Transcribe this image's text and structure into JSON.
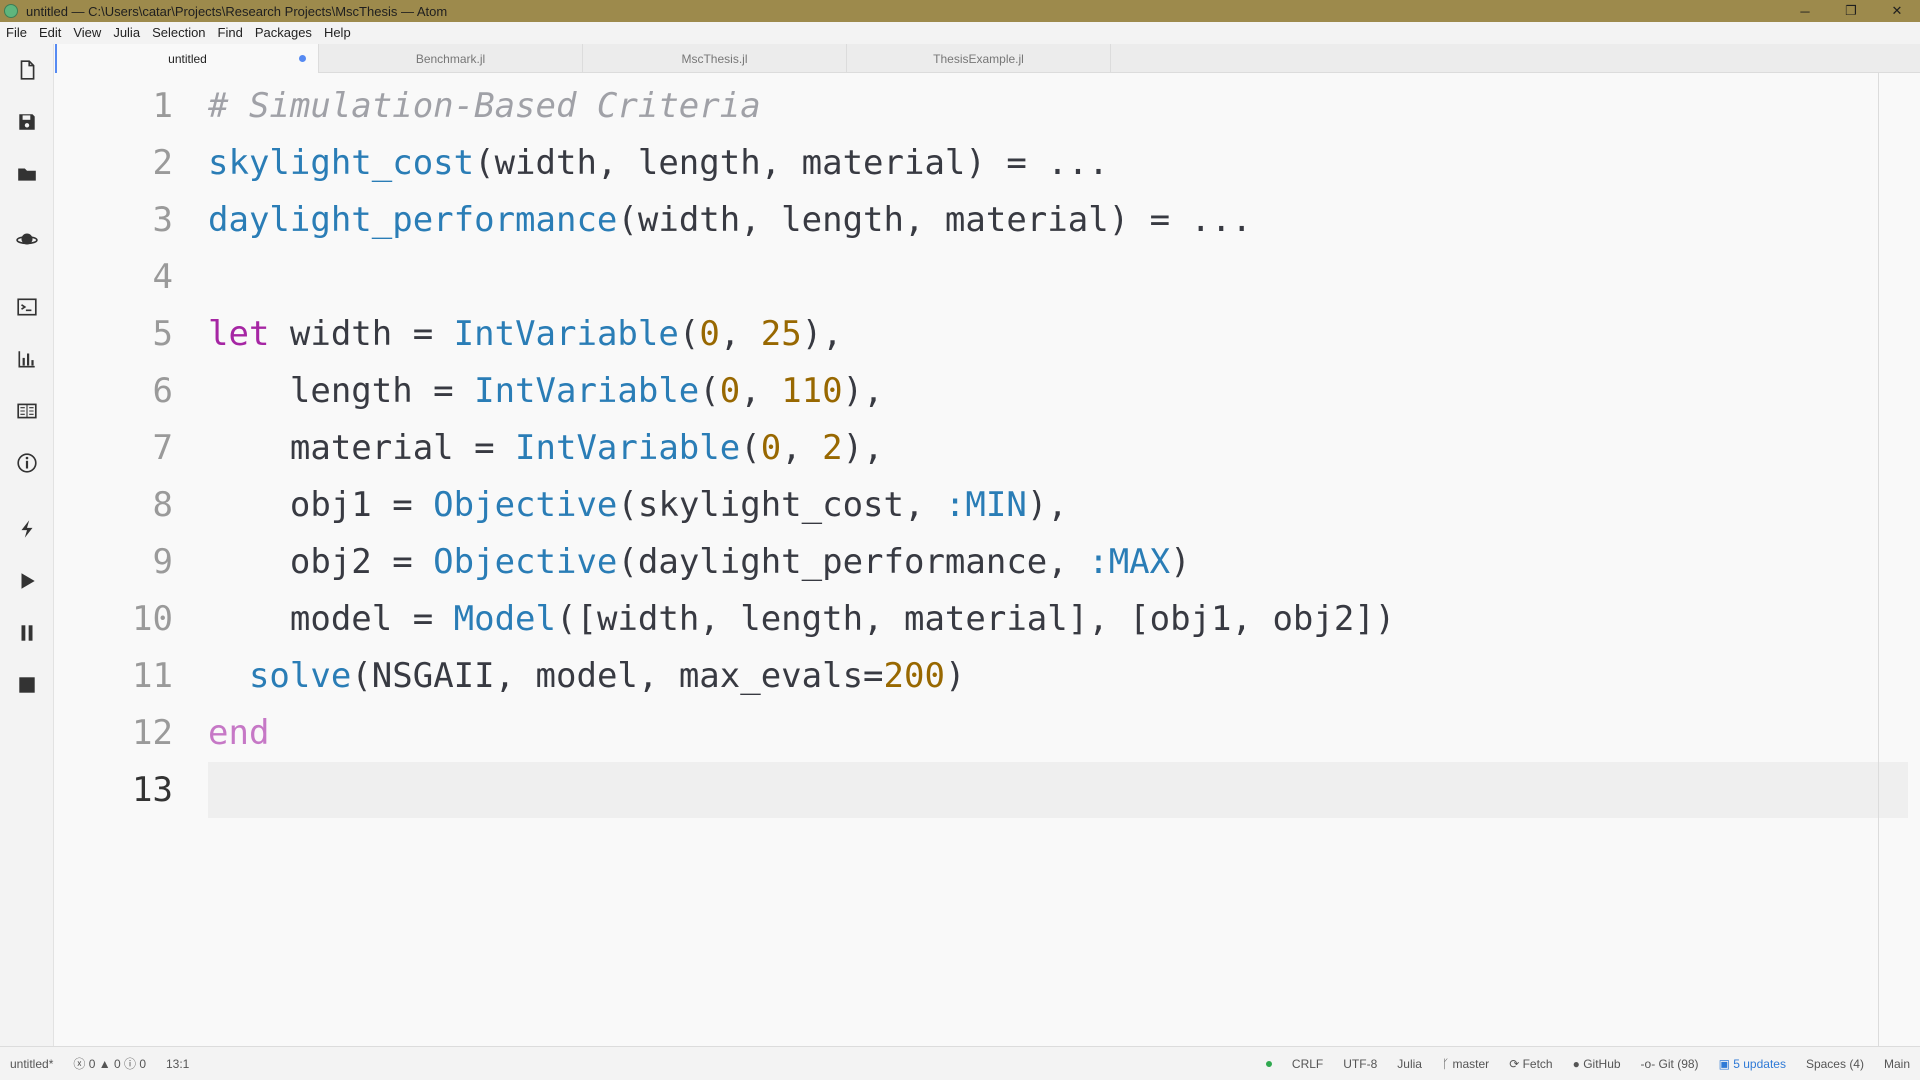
{
  "window": {
    "title": "untitled — C:\\Users\\catar\\Projects\\Research Projects\\MscThesis — Atom",
    "controls": {
      "minimize": "─",
      "maximize": "❐",
      "close": "✕"
    }
  },
  "menu": [
    {
      "label": "File"
    },
    {
      "label": "Edit"
    },
    {
      "label": "View"
    },
    {
      "label": "Julia"
    },
    {
      "label": "Selection"
    },
    {
      "label": "Find"
    },
    {
      "label": "Packages"
    },
    {
      "label": "Help"
    }
  ],
  "tabs": [
    {
      "label": "untitled",
      "active": true,
      "modified": true
    },
    {
      "label": "Benchmark.jl",
      "active": false
    },
    {
      "label": "MscThesis.jl",
      "active": false
    },
    {
      "label": "ThesisExample.jl",
      "active": false
    }
  ],
  "toolbar": [
    "new-file-icon",
    "save-icon",
    "open-folder-icon",
    "planet-icon",
    "terminal-icon",
    "plot-icon",
    "docs-icon",
    "info-icon",
    "lightning-icon",
    "play-icon",
    "pause-icon",
    "stop-icon"
  ],
  "editor": {
    "line_numbers": [
      "1",
      "2",
      "3",
      "4",
      "5",
      "6",
      "7",
      "8",
      "9",
      "10",
      "11",
      "12",
      "13"
    ],
    "lines": [
      [
        {
          "t": "# Simulation-Based Criteria",
          "c": "c-com"
        }
      ],
      [
        {
          "t": "skylight_cost",
          "c": "c-fn"
        },
        {
          "t": "(width, length, material) = ...",
          "c": ""
        }
      ],
      [
        {
          "t": "daylight_performance",
          "c": "c-fn"
        },
        {
          "t": "(width, length, material) = ...",
          "c": ""
        }
      ],
      [],
      [
        {
          "t": "let",
          "c": "c-kw"
        },
        {
          "t": " width = ",
          "c": ""
        },
        {
          "t": "IntVariable",
          "c": "c-fn"
        },
        {
          "t": "(",
          "c": ""
        },
        {
          "t": "0",
          "c": "c-num"
        },
        {
          "t": ", ",
          "c": ""
        },
        {
          "t": "25",
          "c": "c-num"
        },
        {
          "t": "),",
          "c": ""
        }
      ],
      [
        {
          "t": "    length = ",
          "c": ""
        },
        {
          "t": "IntVariable",
          "c": "c-fn"
        },
        {
          "t": "(",
          "c": ""
        },
        {
          "t": "0",
          "c": "c-num"
        },
        {
          "t": ", ",
          "c": ""
        },
        {
          "t": "110",
          "c": "c-num"
        },
        {
          "t": "),",
          "c": ""
        }
      ],
      [
        {
          "t": "    material = ",
          "c": ""
        },
        {
          "t": "IntVariable",
          "c": "c-fn"
        },
        {
          "t": "(",
          "c": ""
        },
        {
          "t": "0",
          "c": "c-num"
        },
        {
          "t": ", ",
          "c": ""
        },
        {
          "t": "2",
          "c": "c-num"
        },
        {
          "t": "),",
          "c": ""
        }
      ],
      [
        {
          "t": "    obj1 = ",
          "c": ""
        },
        {
          "t": "Objective",
          "c": "c-fn"
        },
        {
          "t": "(skylight_cost, ",
          "c": ""
        },
        {
          "t": ":MIN",
          "c": "c-sym"
        },
        {
          "t": "),",
          "c": ""
        }
      ],
      [
        {
          "t": "    obj2 = ",
          "c": ""
        },
        {
          "t": "Objective",
          "c": "c-fn"
        },
        {
          "t": "(daylight_performance, ",
          "c": ""
        },
        {
          "t": ":MAX",
          "c": "c-sym"
        },
        {
          "t": ")",
          "c": ""
        }
      ],
      [
        {
          "t": "    model = ",
          "c": ""
        },
        {
          "t": "Model",
          "c": "c-fn"
        },
        {
          "t": "([width, length, material], [obj1, obj2])",
          "c": ""
        }
      ],
      [
        {
          "t": "  ",
          "c": ""
        },
        {
          "t": "solve",
          "c": "c-fn"
        },
        {
          "t": "(NSGAII, model, max_evals=",
          "c": ""
        },
        {
          "t": "200",
          "c": "c-num"
        },
        {
          "t": ")",
          "c": ""
        }
      ],
      [
        {
          "t": "end",
          "c": "c-kw2"
        }
      ],
      []
    ],
    "current_line": 13
  },
  "status": {
    "file": "untitled*",
    "errors": "0",
    "warnings": "0",
    "infos": "0",
    "cursor": "13:1",
    "line_ending": "CRLF",
    "encoding": "UTF-8",
    "grammar": "Julia",
    "branch": "master",
    "fetch": "Fetch",
    "github": "GitHub",
    "git": "Git (98)",
    "updates": "5 updates",
    "indent": "Spaces (4)",
    "module": "Main"
  },
  "colors": {
    "titlebar": "#9d8a4c",
    "accent": "#568af2",
    "function": "#2a7db6",
    "keyword": "#a626a4",
    "number": "#986801",
    "comment": "#a0a1a7"
  }
}
